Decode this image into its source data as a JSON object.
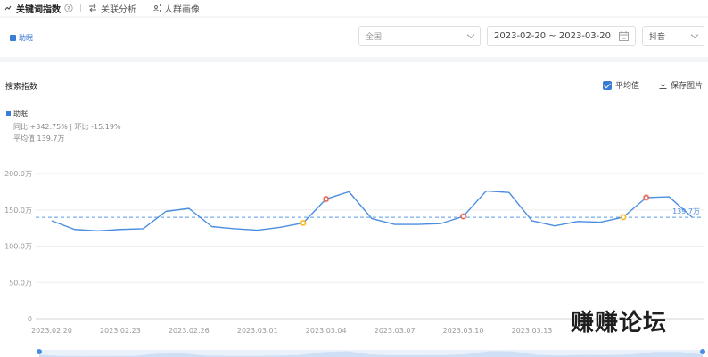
{
  "tabs": [
    {
      "label": "关键词指数",
      "icon": "chart-box-icon",
      "active": true
    },
    {
      "label": "关联分析",
      "icon": "link-arrows-icon",
      "active": false
    },
    {
      "label": "人群画像",
      "icon": "person-frame-icon",
      "active": false
    }
  ],
  "filters": {
    "keyword": "助眠",
    "region": "全国",
    "date_range": "2023-02-20 ~ 2023-03-20",
    "platform": "抖音"
  },
  "panel": {
    "title": "搜索指数",
    "avg_toggle_label": "平均值",
    "avg_toggle_checked": true,
    "save_label": "保存图片"
  },
  "legend": {
    "series_name": "助眠",
    "yoy_mom": "同比 +342.75% | 环比 -15.19%",
    "average": "平均值 139.7万"
  },
  "watermark": "赚赚论坛",
  "chart_data": {
    "type": "line",
    "x": [
      "2023.02.20",
      "2023.02.21",
      "2023.02.22",
      "2023.02.23",
      "2023.02.24",
      "2023.02.25",
      "2023.02.26",
      "2023.02.27",
      "2023.02.28",
      "2023.03.01",
      "2023.03.02",
      "2023.03.03",
      "2023.03.04",
      "2023.03.05",
      "2023.03.06",
      "2023.03.07",
      "2023.03.08",
      "2023.03.09",
      "2023.03.10",
      "2023.03.11",
      "2023.03.12",
      "2023.03.13",
      "2023.03.14",
      "2023.03.15",
      "2023.03.16",
      "2023.03.17",
      "2023.03.18",
      "2023.03.19",
      "2023.03.20"
    ],
    "x_tick_labels": [
      "2023.02.20",
      "2023.02.23",
      "2023.02.26",
      "2023.03.01",
      "2023.03.04",
      "2023.03.07",
      "2023.03.10",
      "2023.03.13"
    ],
    "y_tick_labels": [
      "0",
      "50.0万",
      "100.0万",
      "150.0万",
      "200.0万"
    ],
    "series": [
      {
        "name": "助眠",
        "values": [
          135,
          123,
          121,
          123,
          124,
          148,
          152,
          127,
          124,
          122,
          126,
          132,
          165,
          175,
          138,
          130,
          130,
          131,
          141,
          176,
          174,
          135,
          128,
          134,
          133,
          140,
          167,
          168,
          140
        ]
      }
    ],
    "ylim": [
      0,
      200
    ],
    "average": 139.7,
    "average_label": "139.7万",
    "highlight_points": [
      {
        "x": "2023.03.03",
        "color": "#f5b921"
      },
      {
        "x": "2023.03.04",
        "color": "#e8604c"
      },
      {
        "x": "2023.03.10",
        "color": "#e8604c"
      },
      {
        "x": "2023.03.17",
        "color": "#f5b921"
      },
      {
        "x": "2023.03.18",
        "color": "#e8604c"
      }
    ],
    "line_color": "#4a8ee0",
    "grid": true,
    "legend_position": "top-left"
  }
}
